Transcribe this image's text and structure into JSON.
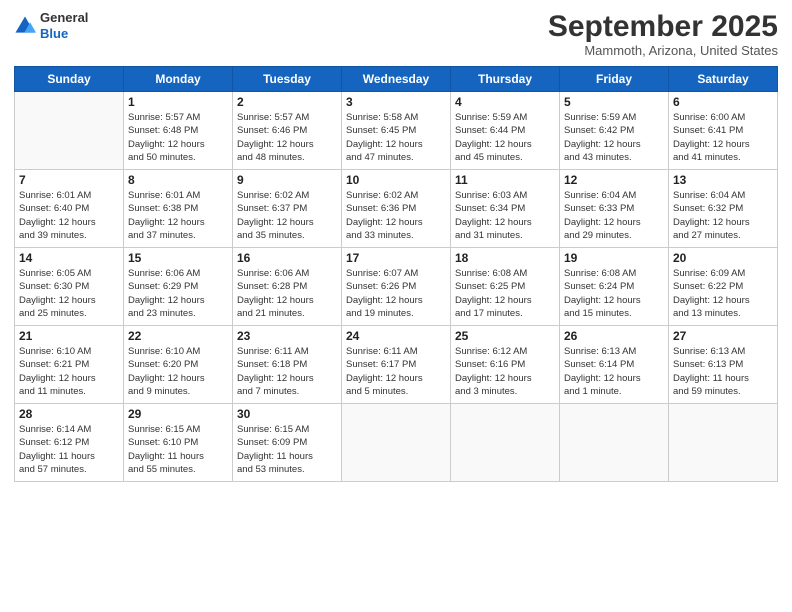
{
  "logo": {
    "general": "General",
    "blue": "Blue"
  },
  "title": "September 2025",
  "location": "Mammoth, Arizona, United States",
  "days_header": [
    "Sunday",
    "Monday",
    "Tuesday",
    "Wednesday",
    "Thursday",
    "Friday",
    "Saturday"
  ],
  "weeks": [
    [
      {
        "num": "",
        "info": ""
      },
      {
        "num": "1",
        "info": "Sunrise: 5:57 AM\nSunset: 6:48 PM\nDaylight: 12 hours\nand 50 minutes."
      },
      {
        "num": "2",
        "info": "Sunrise: 5:57 AM\nSunset: 6:46 PM\nDaylight: 12 hours\nand 48 minutes."
      },
      {
        "num": "3",
        "info": "Sunrise: 5:58 AM\nSunset: 6:45 PM\nDaylight: 12 hours\nand 47 minutes."
      },
      {
        "num": "4",
        "info": "Sunrise: 5:59 AM\nSunset: 6:44 PM\nDaylight: 12 hours\nand 45 minutes."
      },
      {
        "num": "5",
        "info": "Sunrise: 5:59 AM\nSunset: 6:42 PM\nDaylight: 12 hours\nand 43 minutes."
      },
      {
        "num": "6",
        "info": "Sunrise: 6:00 AM\nSunset: 6:41 PM\nDaylight: 12 hours\nand 41 minutes."
      }
    ],
    [
      {
        "num": "7",
        "info": "Sunrise: 6:01 AM\nSunset: 6:40 PM\nDaylight: 12 hours\nand 39 minutes."
      },
      {
        "num": "8",
        "info": "Sunrise: 6:01 AM\nSunset: 6:38 PM\nDaylight: 12 hours\nand 37 minutes."
      },
      {
        "num": "9",
        "info": "Sunrise: 6:02 AM\nSunset: 6:37 PM\nDaylight: 12 hours\nand 35 minutes."
      },
      {
        "num": "10",
        "info": "Sunrise: 6:02 AM\nSunset: 6:36 PM\nDaylight: 12 hours\nand 33 minutes."
      },
      {
        "num": "11",
        "info": "Sunrise: 6:03 AM\nSunset: 6:34 PM\nDaylight: 12 hours\nand 31 minutes."
      },
      {
        "num": "12",
        "info": "Sunrise: 6:04 AM\nSunset: 6:33 PM\nDaylight: 12 hours\nand 29 minutes."
      },
      {
        "num": "13",
        "info": "Sunrise: 6:04 AM\nSunset: 6:32 PM\nDaylight: 12 hours\nand 27 minutes."
      }
    ],
    [
      {
        "num": "14",
        "info": "Sunrise: 6:05 AM\nSunset: 6:30 PM\nDaylight: 12 hours\nand 25 minutes."
      },
      {
        "num": "15",
        "info": "Sunrise: 6:06 AM\nSunset: 6:29 PM\nDaylight: 12 hours\nand 23 minutes."
      },
      {
        "num": "16",
        "info": "Sunrise: 6:06 AM\nSunset: 6:28 PM\nDaylight: 12 hours\nand 21 minutes."
      },
      {
        "num": "17",
        "info": "Sunrise: 6:07 AM\nSunset: 6:26 PM\nDaylight: 12 hours\nand 19 minutes."
      },
      {
        "num": "18",
        "info": "Sunrise: 6:08 AM\nSunset: 6:25 PM\nDaylight: 12 hours\nand 17 minutes."
      },
      {
        "num": "19",
        "info": "Sunrise: 6:08 AM\nSunset: 6:24 PM\nDaylight: 12 hours\nand 15 minutes."
      },
      {
        "num": "20",
        "info": "Sunrise: 6:09 AM\nSunset: 6:22 PM\nDaylight: 12 hours\nand 13 minutes."
      }
    ],
    [
      {
        "num": "21",
        "info": "Sunrise: 6:10 AM\nSunset: 6:21 PM\nDaylight: 12 hours\nand 11 minutes."
      },
      {
        "num": "22",
        "info": "Sunrise: 6:10 AM\nSunset: 6:20 PM\nDaylight: 12 hours\nand 9 minutes."
      },
      {
        "num": "23",
        "info": "Sunrise: 6:11 AM\nSunset: 6:18 PM\nDaylight: 12 hours\nand 7 minutes."
      },
      {
        "num": "24",
        "info": "Sunrise: 6:11 AM\nSunset: 6:17 PM\nDaylight: 12 hours\nand 5 minutes."
      },
      {
        "num": "25",
        "info": "Sunrise: 6:12 AM\nSunset: 6:16 PM\nDaylight: 12 hours\nand 3 minutes."
      },
      {
        "num": "26",
        "info": "Sunrise: 6:13 AM\nSunset: 6:14 PM\nDaylight: 12 hours\nand 1 minute."
      },
      {
        "num": "27",
        "info": "Sunrise: 6:13 AM\nSunset: 6:13 PM\nDaylight: 11 hours\nand 59 minutes."
      }
    ],
    [
      {
        "num": "28",
        "info": "Sunrise: 6:14 AM\nSunset: 6:12 PM\nDaylight: 11 hours\nand 57 minutes."
      },
      {
        "num": "29",
        "info": "Sunrise: 6:15 AM\nSunset: 6:10 PM\nDaylight: 11 hours\nand 55 minutes."
      },
      {
        "num": "30",
        "info": "Sunrise: 6:15 AM\nSunset: 6:09 PM\nDaylight: 11 hours\nand 53 minutes."
      },
      {
        "num": "",
        "info": ""
      },
      {
        "num": "",
        "info": ""
      },
      {
        "num": "",
        "info": ""
      },
      {
        "num": "",
        "info": ""
      }
    ]
  ]
}
